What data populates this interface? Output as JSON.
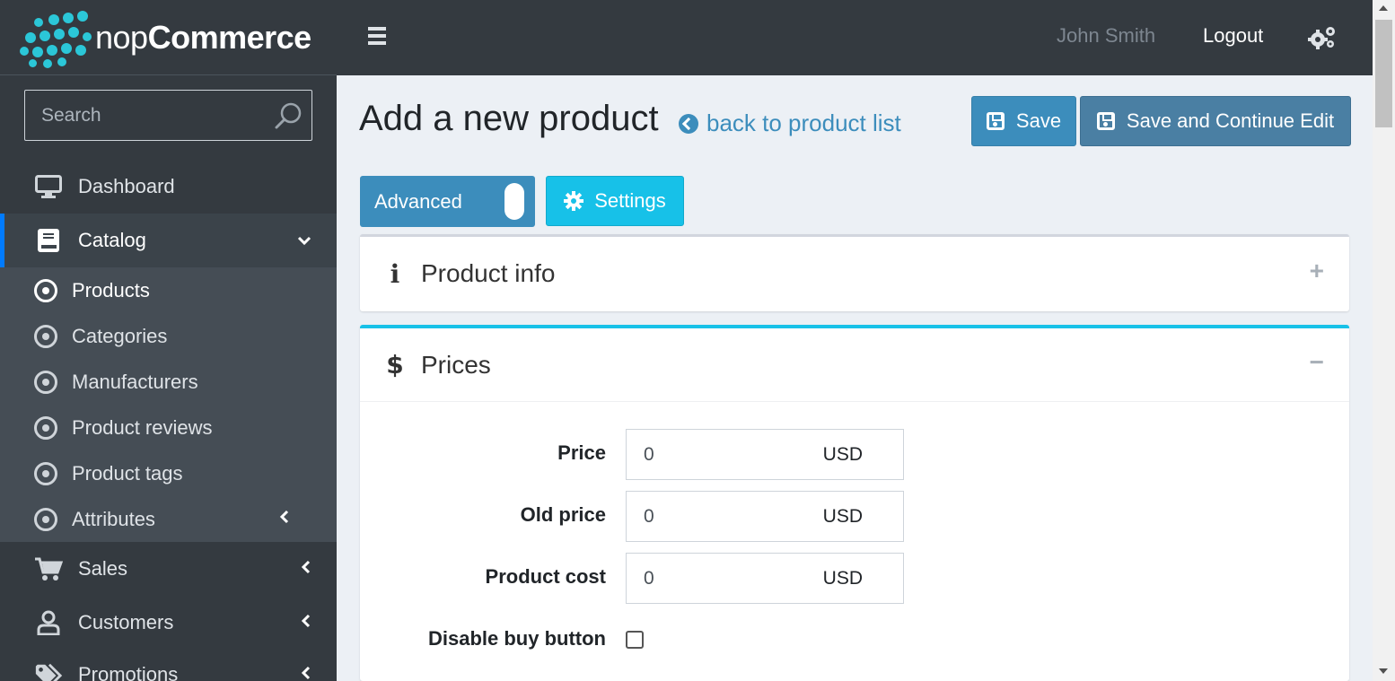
{
  "brand": {
    "prefix": "nop",
    "suffix": "Commerce"
  },
  "search": {
    "placeholder": "Search"
  },
  "sidebar": {
    "items": [
      {
        "label": "Dashboard",
        "icon": "monitor-icon"
      },
      {
        "label": "Catalog",
        "icon": "book-icon"
      },
      {
        "label": "Sales",
        "icon": "cart-icon"
      },
      {
        "label": "Customers",
        "icon": "user-icon"
      },
      {
        "label": "Promotions",
        "icon": "tags-icon"
      }
    ],
    "catalog_sub": [
      {
        "label": "Products"
      },
      {
        "label": "Categories"
      },
      {
        "label": "Manufacturers"
      },
      {
        "label": "Product reviews"
      },
      {
        "label": "Product tags"
      },
      {
        "label": "Attributes"
      }
    ]
  },
  "topbar": {
    "user": "John Smith",
    "logout": "Logout"
  },
  "page": {
    "title": "Add a new product",
    "back_link": "back to product list",
    "save": "Save",
    "save_continue": "Save and Continue Edit",
    "advanced": "Advanced",
    "settings": "Settings"
  },
  "cards": {
    "product_info": {
      "title": "Product info",
      "toggle": "+"
    },
    "prices": {
      "title": "Prices",
      "toggle": "−"
    }
  },
  "prices_form": {
    "price": {
      "label": "Price",
      "value": "0",
      "currency": "USD"
    },
    "old_price": {
      "label": "Old price",
      "value": "0",
      "currency": "USD"
    },
    "product_cost": {
      "label": "Product cost",
      "value": "0",
      "currency": "USD"
    },
    "disable_buy": {
      "label": "Disable buy button",
      "checked": false
    }
  },
  "colors": {
    "sidebar": "#343a40",
    "accent": "#3c8dbc",
    "info": "#17c1e8",
    "brand_dots": "#2bc7d8"
  }
}
